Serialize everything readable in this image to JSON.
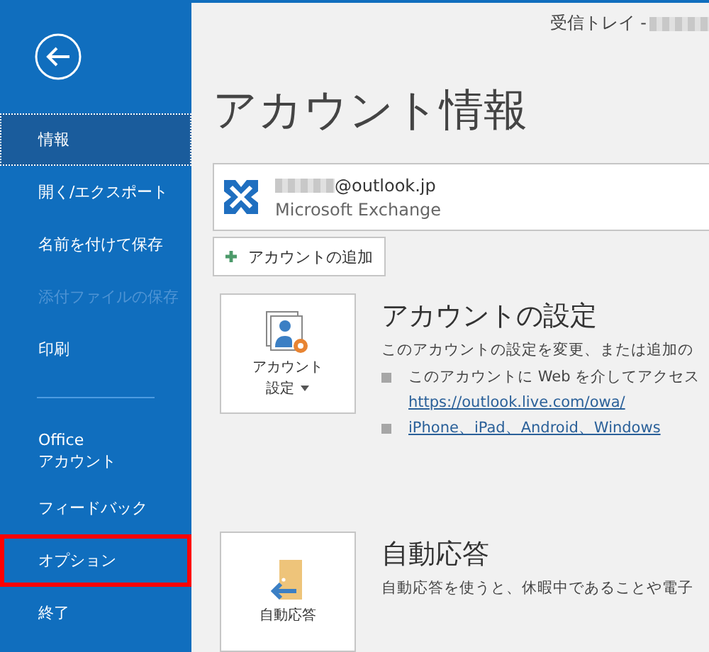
{
  "window": {
    "title": "受信トレイ - "
  },
  "sidebar": {
    "items": [
      {
        "kind": "item",
        "label": "情報",
        "selected": true,
        "disabled": false,
        "highlighted": false
      },
      {
        "kind": "item",
        "label": "開く/エクスポート",
        "selected": false,
        "disabled": false,
        "highlighted": false
      },
      {
        "kind": "item",
        "label": "名前を付けて保存",
        "selected": false,
        "disabled": false,
        "highlighted": false
      },
      {
        "kind": "item",
        "label": "添付ファイルの保存",
        "selected": false,
        "disabled": true,
        "highlighted": false
      },
      {
        "kind": "item",
        "label": "印刷",
        "selected": false,
        "disabled": false,
        "highlighted": false
      },
      {
        "kind": "divider"
      },
      {
        "kind": "item",
        "label": "Office\nアカウント",
        "selected": false,
        "disabled": false,
        "highlighted": false
      },
      {
        "kind": "item",
        "label": "フィードバック",
        "selected": false,
        "disabled": false,
        "highlighted": false
      },
      {
        "kind": "item",
        "label": "オプション",
        "selected": false,
        "disabled": false,
        "highlighted": true
      },
      {
        "kind": "item",
        "label": "終了",
        "selected": false,
        "disabled": false,
        "highlighted": false
      }
    ]
  },
  "main": {
    "heading": "アカウント情報",
    "account": {
      "email": "@outlook.jp",
      "type": "Microsoft Exchange"
    },
    "add_account_button": "アカウントの追加",
    "sections": [
      {
        "kind": "settings",
        "tile_lines": [
          "アカウント",
          "設定"
        ],
        "dropdown": true,
        "title": "アカウントの設定",
        "description": "このアカウントの設定を変更、または追加の",
        "bullets": [
          {
            "text": "このアカウントに Web を介してアクセス",
            "link": "https://outlook.live.com/owa/"
          },
          {
            "link": "iPhone、iPad、Android、Windows"
          }
        ]
      },
      {
        "kind": "autoreply",
        "tile_lines": [
          "自動応答"
        ],
        "dropdown": false,
        "title": "自動応答",
        "description": "自動応答を使うと、休暇中であることや電子"
      }
    ]
  }
}
